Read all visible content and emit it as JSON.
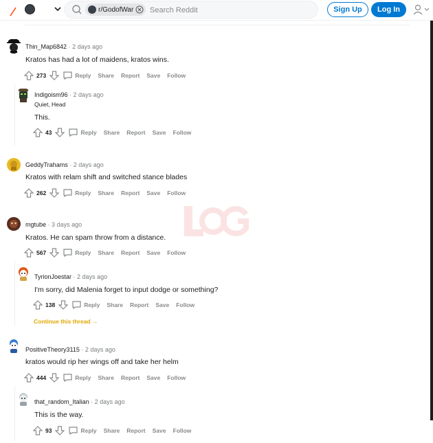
{
  "header": {
    "subreddit_chip": "r/GodofWar",
    "search_placeholder": "Search Reddit",
    "signup_label": "Sign Up",
    "login_label": "Log In"
  },
  "actions": {
    "reply": "Reply",
    "share": "Share",
    "report": "Report",
    "save": "Save",
    "follow": "Follow"
  },
  "comments": [
    {
      "author": "Thin_Map6842",
      "time": "2 days ago",
      "flair": "",
      "body": "Kratos has had a lot of maidens, kratos wins.",
      "score": "273"
    },
    {
      "author": "Indigoism96",
      "time": "2 days ago",
      "flair": "Quiet, Head",
      "body": "This.",
      "score": "43"
    },
    {
      "author": "GeddyTrahams",
      "time": "2 days ago",
      "flair": "",
      "body": "Kratos with relam shift and switched stance blades",
      "score": "262"
    },
    {
      "author": "mgtube",
      "time": "3 days ago",
      "flair": "",
      "body": "Kratos. He can spam throw from a distance.",
      "score": "567"
    },
    {
      "author": "TyrionJoestar",
      "time": "2 days ago",
      "flair": "",
      "body": "I'm sorry, did Malenia forget to input dodge or something?",
      "score": "138"
    },
    {
      "author": "PositiveTheory3115",
      "time": "2 days ago",
      "flair": "",
      "body": "kratos would rip her wings off and take her helm",
      "score": "444"
    },
    {
      "author": "that_random_Italian",
      "time": "2 days ago",
      "flair": "",
      "body": "This is the way.",
      "score": "93"
    }
  ],
  "continue_thread": "Continue this thread",
  "colors": {
    "brand_blue": "#0079d3",
    "continue_yellow": "#e0a800",
    "muted": "#878a8c"
  }
}
